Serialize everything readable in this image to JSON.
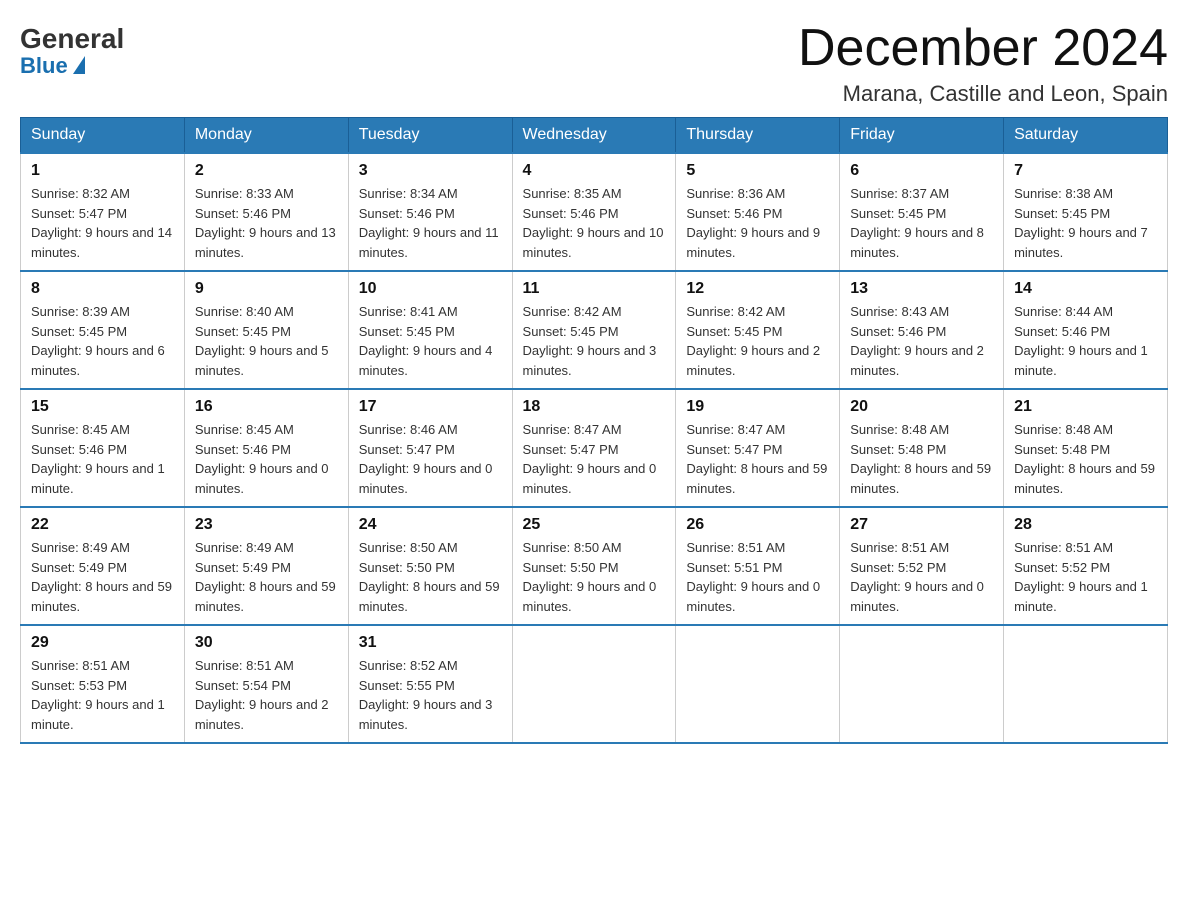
{
  "header": {
    "logo_general": "General",
    "logo_blue": "Blue",
    "month_title": "December 2024",
    "location": "Marana, Castille and Leon, Spain"
  },
  "days_of_week": [
    "Sunday",
    "Monday",
    "Tuesday",
    "Wednesday",
    "Thursday",
    "Friday",
    "Saturday"
  ],
  "weeks": [
    [
      {
        "day": "1",
        "sunrise": "8:32 AM",
        "sunset": "5:47 PM",
        "daylight": "9 hours and 14 minutes."
      },
      {
        "day": "2",
        "sunrise": "8:33 AM",
        "sunset": "5:46 PM",
        "daylight": "9 hours and 13 minutes."
      },
      {
        "day": "3",
        "sunrise": "8:34 AM",
        "sunset": "5:46 PM",
        "daylight": "9 hours and 11 minutes."
      },
      {
        "day": "4",
        "sunrise": "8:35 AM",
        "sunset": "5:46 PM",
        "daylight": "9 hours and 10 minutes."
      },
      {
        "day": "5",
        "sunrise": "8:36 AM",
        "sunset": "5:46 PM",
        "daylight": "9 hours and 9 minutes."
      },
      {
        "day": "6",
        "sunrise": "8:37 AM",
        "sunset": "5:45 PM",
        "daylight": "9 hours and 8 minutes."
      },
      {
        "day": "7",
        "sunrise": "8:38 AM",
        "sunset": "5:45 PM",
        "daylight": "9 hours and 7 minutes."
      }
    ],
    [
      {
        "day": "8",
        "sunrise": "8:39 AM",
        "sunset": "5:45 PM",
        "daylight": "9 hours and 6 minutes."
      },
      {
        "day": "9",
        "sunrise": "8:40 AM",
        "sunset": "5:45 PM",
        "daylight": "9 hours and 5 minutes."
      },
      {
        "day": "10",
        "sunrise": "8:41 AM",
        "sunset": "5:45 PM",
        "daylight": "9 hours and 4 minutes."
      },
      {
        "day": "11",
        "sunrise": "8:42 AM",
        "sunset": "5:45 PM",
        "daylight": "9 hours and 3 minutes."
      },
      {
        "day": "12",
        "sunrise": "8:42 AM",
        "sunset": "5:45 PM",
        "daylight": "9 hours and 2 minutes."
      },
      {
        "day": "13",
        "sunrise": "8:43 AM",
        "sunset": "5:46 PM",
        "daylight": "9 hours and 2 minutes."
      },
      {
        "day": "14",
        "sunrise": "8:44 AM",
        "sunset": "5:46 PM",
        "daylight": "9 hours and 1 minute."
      }
    ],
    [
      {
        "day": "15",
        "sunrise": "8:45 AM",
        "sunset": "5:46 PM",
        "daylight": "9 hours and 1 minute."
      },
      {
        "day": "16",
        "sunrise": "8:45 AM",
        "sunset": "5:46 PM",
        "daylight": "9 hours and 0 minutes."
      },
      {
        "day": "17",
        "sunrise": "8:46 AM",
        "sunset": "5:47 PM",
        "daylight": "9 hours and 0 minutes."
      },
      {
        "day": "18",
        "sunrise": "8:47 AM",
        "sunset": "5:47 PM",
        "daylight": "9 hours and 0 minutes."
      },
      {
        "day": "19",
        "sunrise": "8:47 AM",
        "sunset": "5:47 PM",
        "daylight": "8 hours and 59 minutes."
      },
      {
        "day": "20",
        "sunrise": "8:48 AM",
        "sunset": "5:48 PM",
        "daylight": "8 hours and 59 minutes."
      },
      {
        "day": "21",
        "sunrise": "8:48 AM",
        "sunset": "5:48 PM",
        "daylight": "8 hours and 59 minutes."
      }
    ],
    [
      {
        "day": "22",
        "sunrise": "8:49 AM",
        "sunset": "5:49 PM",
        "daylight": "8 hours and 59 minutes."
      },
      {
        "day": "23",
        "sunrise": "8:49 AM",
        "sunset": "5:49 PM",
        "daylight": "8 hours and 59 minutes."
      },
      {
        "day": "24",
        "sunrise": "8:50 AM",
        "sunset": "5:50 PM",
        "daylight": "8 hours and 59 minutes."
      },
      {
        "day": "25",
        "sunrise": "8:50 AM",
        "sunset": "5:50 PM",
        "daylight": "9 hours and 0 minutes."
      },
      {
        "day": "26",
        "sunrise": "8:51 AM",
        "sunset": "5:51 PM",
        "daylight": "9 hours and 0 minutes."
      },
      {
        "day": "27",
        "sunrise": "8:51 AM",
        "sunset": "5:52 PM",
        "daylight": "9 hours and 0 minutes."
      },
      {
        "day": "28",
        "sunrise": "8:51 AM",
        "sunset": "5:52 PM",
        "daylight": "9 hours and 1 minute."
      }
    ],
    [
      {
        "day": "29",
        "sunrise": "8:51 AM",
        "sunset": "5:53 PM",
        "daylight": "9 hours and 1 minute."
      },
      {
        "day": "30",
        "sunrise": "8:51 AM",
        "sunset": "5:54 PM",
        "daylight": "9 hours and 2 minutes."
      },
      {
        "day": "31",
        "sunrise": "8:52 AM",
        "sunset": "5:55 PM",
        "daylight": "9 hours and 3 minutes."
      },
      null,
      null,
      null,
      null
    ]
  ],
  "labels": {
    "sunrise": "Sunrise:",
    "sunset": "Sunset:",
    "daylight": "Daylight:"
  }
}
